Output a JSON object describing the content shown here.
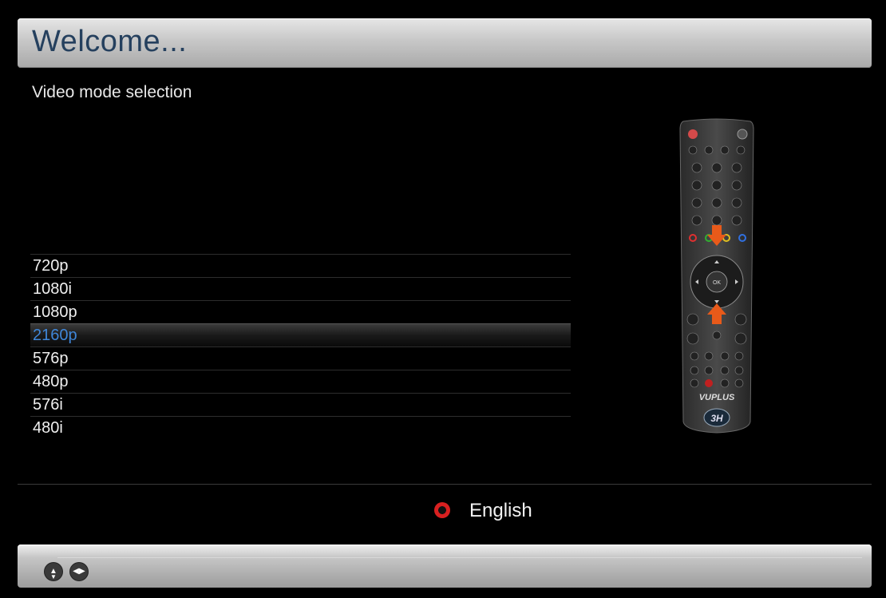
{
  "header": {
    "title": "Welcome..."
  },
  "subtitle": "Video mode selection",
  "video_modes": {
    "items": [
      "720p",
      "1080i",
      "1080p",
      "2160p",
      "576p",
      "480p",
      "576i",
      "480i"
    ],
    "selected": "2160p"
  },
  "remote": {
    "brand": "VUPLUS",
    "logo": "3H",
    "ok_label": "OK"
  },
  "language": {
    "label": "English",
    "icon": "red-button-icon"
  },
  "footer": {
    "icons": [
      "up-down-arrows-icon",
      "left-right-arrows-icon"
    ]
  },
  "colors": {
    "selected_text": "#3f86d8",
    "header_title": "#25405e",
    "header_bg": "#c7c7c7"
  }
}
